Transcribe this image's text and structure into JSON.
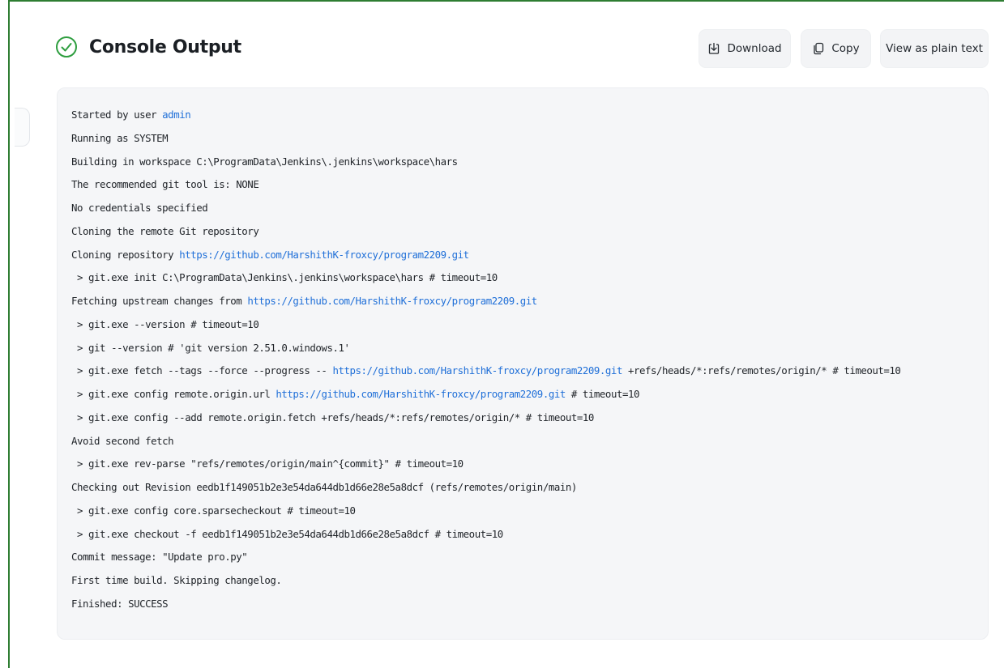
{
  "header": {
    "title": "Console Output",
    "buttons": {
      "download": "Download",
      "copy": "Copy",
      "plain": "View as plain text"
    }
  },
  "colors": {
    "success": "#2e9e3f",
    "link": "#1f6fd8",
    "frame": "#2e7d32"
  },
  "console": {
    "lines": [
      {
        "pre": "Started by user ",
        "link": "admin",
        "post": ""
      },
      {
        "pre": "Running as SYSTEM",
        "link": "",
        "post": ""
      },
      {
        "pre": "Building in workspace C:\\ProgramData\\Jenkins\\.jenkins\\workspace\\hars",
        "link": "",
        "post": ""
      },
      {
        "pre": "The recommended git tool is: NONE",
        "link": "",
        "post": ""
      },
      {
        "pre": "No credentials specified",
        "link": "",
        "post": ""
      },
      {
        "pre": "Cloning the remote Git repository",
        "link": "",
        "post": ""
      },
      {
        "pre": "Cloning repository ",
        "link": "https://github.com/HarshithK-froxcy/program2209.git",
        "post": ""
      },
      {
        "pre": " > git.exe init C:\\ProgramData\\Jenkins\\.jenkins\\workspace\\hars # timeout=10",
        "link": "",
        "post": ""
      },
      {
        "pre": "Fetching upstream changes from ",
        "link": "https://github.com/HarshithK-froxcy/program2209.git",
        "post": ""
      },
      {
        "pre": " > git.exe --version # timeout=10",
        "link": "",
        "post": ""
      },
      {
        "pre": " > git --version # 'git version 2.51.0.windows.1'",
        "link": "",
        "post": ""
      },
      {
        "pre": " > git.exe fetch --tags --force --progress -- ",
        "link": "https://github.com/HarshithK-froxcy/program2209.git",
        "post": " +refs/heads/*:refs/remotes/origin/* # timeout=10"
      },
      {
        "pre": " > git.exe config remote.origin.url ",
        "link": "https://github.com/HarshithK-froxcy/program2209.git",
        "post": " # timeout=10"
      },
      {
        "pre": " > git.exe config --add remote.origin.fetch +refs/heads/*:refs/remotes/origin/* # timeout=10",
        "link": "",
        "post": ""
      },
      {
        "pre": "Avoid second fetch",
        "link": "",
        "post": ""
      },
      {
        "pre": " > git.exe rev-parse \"refs/remotes/origin/main^{commit}\" # timeout=10",
        "link": "",
        "post": ""
      },
      {
        "pre": "Checking out Revision eedb1f149051b2e3e54da644db1d66e28e5a8dcf (refs/remotes/origin/main)",
        "link": "",
        "post": ""
      },
      {
        "pre": " > git.exe config core.sparsecheckout # timeout=10",
        "link": "",
        "post": ""
      },
      {
        "pre": " > git.exe checkout -f eedb1f149051b2e3e54da644db1d66e28e5a8dcf # timeout=10",
        "link": "",
        "post": ""
      },
      {
        "pre": "Commit message: \"Update pro.py\"",
        "link": "",
        "post": ""
      },
      {
        "pre": "First time build. Skipping changelog.",
        "link": "",
        "post": ""
      },
      {
        "pre": "Finished: SUCCESS",
        "link": "",
        "post": ""
      }
    ]
  }
}
